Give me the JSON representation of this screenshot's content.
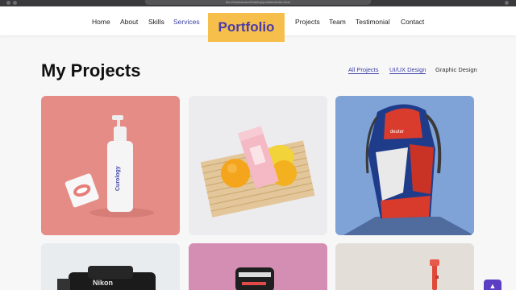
{
  "browser": {
    "url": "file:///Users/user/Desktop/portfolio/index.html"
  },
  "navbar": {
    "left_links": [
      "Home",
      "About",
      "Skills",
      "Services"
    ],
    "brand": "Portfolio",
    "right_links": [
      "Projects",
      "Team",
      "Testimonial",
      "Contact"
    ],
    "active_link": "Services"
  },
  "projects": {
    "title": "My Projects",
    "filters": [
      "All Projects",
      "UI/UX Design",
      "Graphic Design"
    ],
    "active_filter": "All Projects",
    "cards": [
      {
        "label": "Curology",
        "background": "#e58c87"
      },
      {
        "label": "",
        "background": "#ececee"
      },
      {
        "label": "deuter",
        "background": "#7fa3d7"
      },
      {
        "label": "Nikon",
        "background": "#e9ecef"
      },
      {
        "label": "",
        "background": "#d58eb3"
      },
      {
        "label": "",
        "background": "#e4ded9"
      }
    ]
  },
  "colors": {
    "accent": "#3b3fa3",
    "brand_bg": "#f6bf4c",
    "brand_text": "#4b3aa8",
    "scroll_button": "#5b3ec4"
  },
  "icons": {
    "scroll_top": "arrow-up-icon"
  }
}
